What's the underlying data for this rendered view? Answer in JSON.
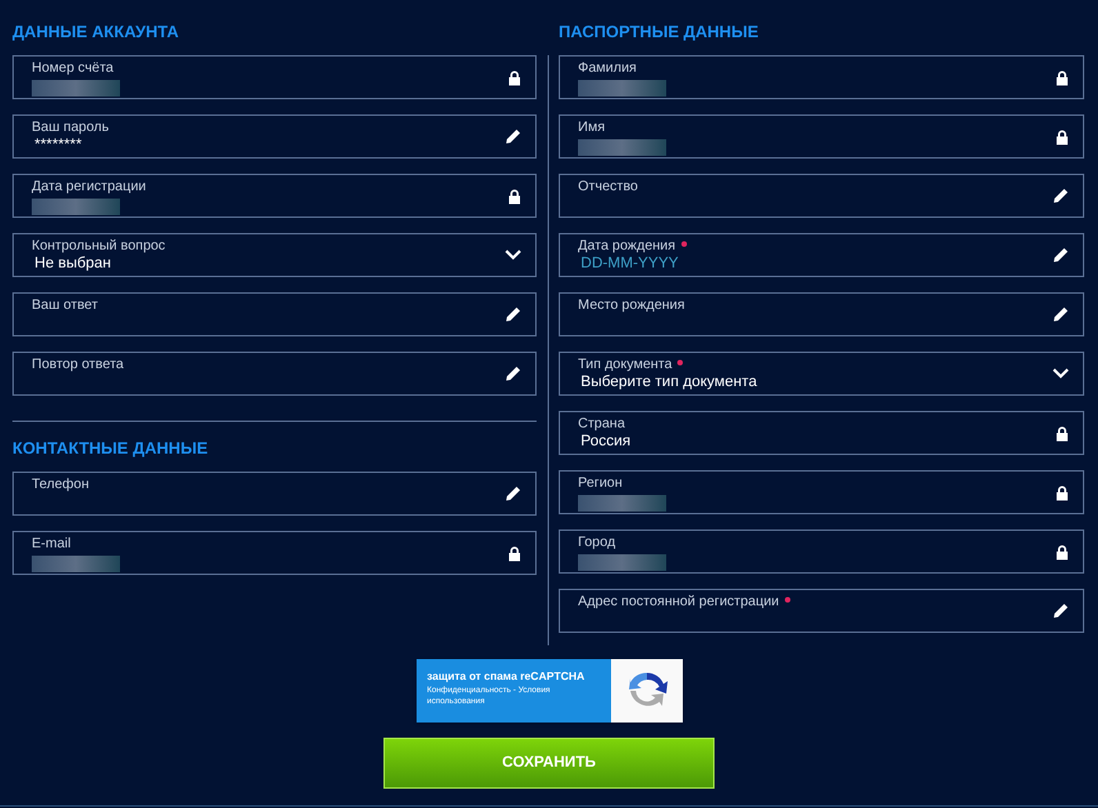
{
  "account": {
    "title": "ДАННЫЕ АККАУНТА",
    "fields": [
      {
        "label": "Номер счёта",
        "kind": "locked",
        "redacted": true
      },
      {
        "label": "Ваш пароль",
        "kind": "editable",
        "value": "********"
      },
      {
        "label": "Дата регистрации",
        "kind": "locked",
        "redacted": true
      },
      {
        "label": "Контрольный вопрос",
        "kind": "select",
        "value": "Не выбран"
      },
      {
        "label": "Ваш ответ",
        "kind": "editable"
      },
      {
        "label": "Повтор ответа",
        "kind": "editable"
      }
    ]
  },
  "contacts": {
    "title": "КОНТАКТНЫЕ ДАННЫЕ",
    "fields": [
      {
        "label": "Телефон",
        "kind": "editable"
      },
      {
        "label": "E-mail",
        "kind": "locked",
        "redacted": true
      }
    ]
  },
  "passport": {
    "title": "ПАСПОРТНЫЕ ДАННЫЕ",
    "fields": [
      {
        "label": "Фамилия",
        "kind": "locked",
        "redacted": true
      },
      {
        "label": "Имя",
        "kind": "locked",
        "redacted": true
      },
      {
        "label": "Отчество",
        "kind": "editable"
      },
      {
        "label": "Дата рождения",
        "kind": "editable",
        "placeholder": "DD-MM-YYYY",
        "required": true
      },
      {
        "label": "Место рождения",
        "kind": "editable"
      },
      {
        "label": "Тип документа",
        "kind": "select",
        "value": "Выберите тип документа",
        "required": true
      },
      {
        "label": "Страна",
        "kind": "locked",
        "value": "Россия"
      },
      {
        "label": "Регион",
        "kind": "locked",
        "redacted": true
      },
      {
        "label": "Город",
        "kind": "locked",
        "redacted": true
      },
      {
        "label": "Адрес постоянной регистрации",
        "kind": "editable",
        "required": true
      }
    ]
  },
  "recaptcha": {
    "title": "защита от спама reCAPTCHA",
    "links": "Конфиденциальность - Условия использования"
  },
  "save_button": "СОХРАНИТЬ"
}
